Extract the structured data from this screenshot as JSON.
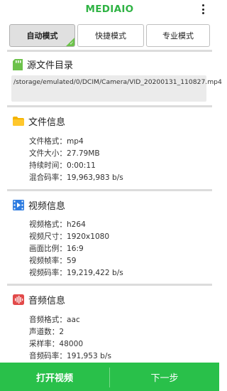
{
  "app": {
    "title": "MEDIAIO"
  },
  "tabs": [
    {
      "label": "自动模式",
      "active": true
    },
    {
      "label": "快捷模式",
      "active": false
    },
    {
      "label": "专业模式",
      "active": false
    }
  ],
  "source": {
    "title": "源文件目录",
    "path": "/storage/emulated/0/DCIM/Camera/VID_20200131_110827.mp4"
  },
  "file_info": {
    "title": "文件信息",
    "rows": [
      {
        "label": "文件格式：",
        "value": "mp4"
      },
      {
        "label": "文件大小：",
        "value": "27.79MB"
      },
      {
        "label": "持续时间：",
        "value": "0:00:11"
      },
      {
        "label": "混合码率：",
        "value": "19,963,983 b/s"
      }
    ]
  },
  "video_info": {
    "title": "视频信息",
    "rows": [
      {
        "label": "视频格式：",
        "value": "h264"
      },
      {
        "label": "视频尺寸：",
        "value": "1920x1080"
      },
      {
        "label": "画面比例：",
        "value": "16:9"
      },
      {
        "label": "视频帧率：",
        "value": "59"
      },
      {
        "label": "视频码率：",
        "value": "19,219,422 b/s"
      }
    ]
  },
  "audio_info": {
    "title": "音频信息",
    "rows": [
      {
        "label": "音频格式：",
        "value": "aac"
      },
      {
        "label": "声道数：",
        "value": "2"
      },
      {
        "label": "采样率：",
        "value": "48000"
      },
      {
        "label": "音频码率：",
        "value": "191,953 b/s"
      }
    ]
  },
  "bottom": {
    "open_label": "打开视频",
    "next_label": "下一步"
  },
  "colors": {
    "brand": "#2fb344",
    "bottom_bar": "#29c04a",
    "folder": "#f5b400",
    "video": "#2f7de1",
    "audio": "#e24a4a"
  }
}
